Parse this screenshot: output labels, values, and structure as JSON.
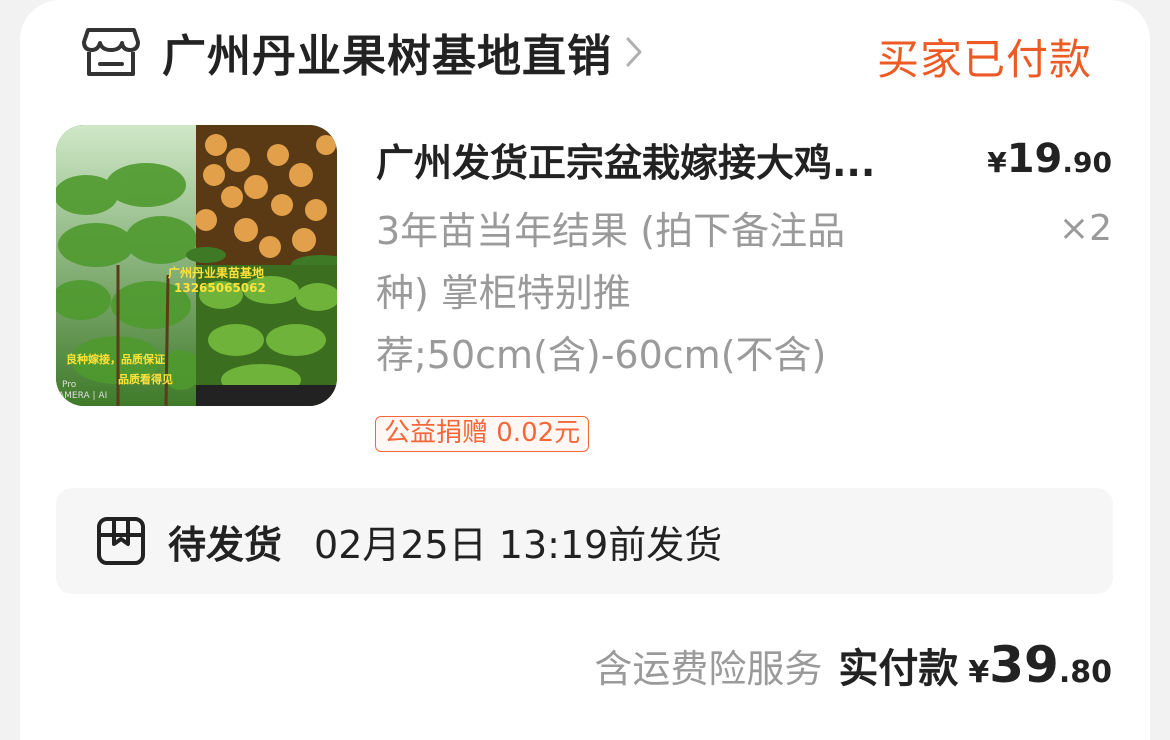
{
  "shop": {
    "name": "广州丹业果树基地直销",
    "icon": "store-icon",
    "chevron": "chevron-right-icon"
  },
  "order": {
    "status": "买家已付款"
  },
  "product": {
    "title": "广州发货正宗盆栽嫁接大鸡...",
    "price": {
      "currency": "¥",
      "integer": "19",
      "decimal": ".90"
    },
    "spec_lines": [
      "3年苗当年结果 (拍下备注品",
      "种) 掌柜特别推",
      "荐;50cm(含)-60cm(不含)"
    ],
    "quantity": "×2",
    "donation_tag": "公益捐赠 0.02元",
    "image_text": {
      "caption1": "广州丹业果苗基地",
      "caption2": "13265065062",
      "caption3": "良种嫁接，品质保证",
      "caption4": "品质看得见",
      "watermark1": "Pro",
      "watermark2": "AMERA | AI"
    }
  },
  "shipping": {
    "icon": "package-icon",
    "status": "待发货",
    "time": "02月25日 13:19前发货"
  },
  "footer": {
    "insurance": "含运费险服务",
    "paid_label": "实付款",
    "total": {
      "currency": "¥",
      "integer": "39",
      "decimal": ".80"
    }
  },
  "colors": {
    "accent": "#ee5a24",
    "text": "#222222",
    "muted": "#9a9a9a"
  }
}
